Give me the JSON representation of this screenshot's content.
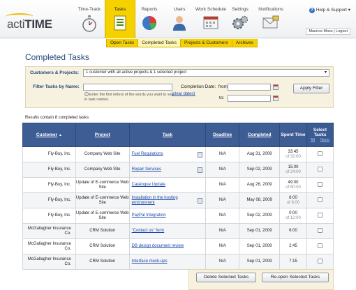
{
  "app": {
    "logo_acti": "acti",
    "logo_time": "TIME"
  },
  "nav": [
    {
      "label": "Time-Track"
    },
    {
      "label": "Tasks"
    },
    {
      "label": "Reports"
    },
    {
      "label": "Users"
    },
    {
      "label": "Work Schedule"
    },
    {
      "label": "Settings"
    },
    {
      "label": "Notifications"
    }
  ],
  "help": {
    "label": "Help & Support",
    "caret": "▾"
  },
  "user": {
    "name": "Maurice Moss",
    "logout": "Logout"
  },
  "subnav": [
    "Open Tasks",
    "Completed Tasks",
    "Projects & Customers",
    "Archives"
  ],
  "page": {
    "title": "Completed Tasks"
  },
  "filter": {
    "cp_label": "Customers & Projects:",
    "cp_value": "1 customer with all active projects & 1 selected project",
    "name_label": "Filter Tasks by Name:",
    "hint": "Enter the first letters of the words you want to see in task names.",
    "date_label": "Completion Date:",
    "from": "from:",
    "to": "to:",
    "clear": "(clear dates)",
    "apply": "Apply Filter"
  },
  "results": {
    "text": "Results contain 8 completed tasks"
  },
  "table": {
    "headers": {
      "customer": "Customer",
      "project": "Project",
      "task": "Task",
      "deadline": "Deadline",
      "completed": "Completed",
      "spent": "Spent Time",
      "select": "Select Tasks",
      "all": "All",
      "none": "None",
      "sort_arrow": "▲"
    },
    "rows": [
      {
        "customer": "Fly-Buy, Inc.",
        "project": "Company Web Site",
        "task": "Fuel Regulations",
        "note": true,
        "deadline": "N/A",
        "completed": "Aug 31, 2009",
        "time": "33:45",
        "of": "of 32:00"
      },
      {
        "customer": "Fly-Buy, Inc.",
        "project": "Company Web Site",
        "task": "Repair Services",
        "note": true,
        "deadline": "N/A",
        "completed": "Sep 02, 2009",
        "time": "15:00",
        "of": "of 24:00"
      },
      {
        "customer": "Fly-Buy, Inc.",
        "project": "Update of E-commerce Web Site",
        "task": "Catalogue Update",
        "note": false,
        "deadline": "N/A",
        "completed": "Aug 26, 2009",
        "time": "49:00",
        "of": "of 60:00"
      },
      {
        "customer": "Fly-Buy, Inc.",
        "project": "Update of E-commerce Web Site",
        "task": "Installation in the hosting environment",
        "note": true,
        "deadline": "N/A",
        "completed": "May 08, 2009",
        "time": "8:00",
        "of": "of 8:00"
      },
      {
        "customer": "Fly-Buy, Inc.",
        "project": "Update of E-commerce Web Site",
        "task": "PayPal Integration",
        "note": false,
        "deadline": "N/A",
        "completed": "Sep 02, 2009",
        "time": "0:00",
        "of": "of 12:00"
      },
      {
        "customer": "McGallagher Insurance Co.",
        "project": "CRM Solution",
        "task": "\"Contact us\" form",
        "note": false,
        "deadline": "N/A",
        "completed": "Sep 01, 2009",
        "time": "6:00",
        "of": ""
      },
      {
        "customer": "McGallagher Insurance Co.",
        "project": "CRM Solution",
        "task": "DB design document review",
        "note": false,
        "deadline": "N/A",
        "completed": "Sep 01, 2009",
        "time": "2:45",
        "of": ""
      },
      {
        "customer": "McGallagher Insurance Co.",
        "project": "CRM Solution",
        "task": "Interface mock-ups",
        "note": false,
        "deadline": "N/A",
        "completed": "Sep 01, 2009",
        "time": "7:15",
        "of": ""
      }
    ]
  },
  "actions": {
    "delete": "Delete Selected Tasks",
    "reopen": "Re-open Selected Tasks"
  },
  "colors": {
    "accent": "#f5d100",
    "header_blue": "#3d5d94",
    "link": "#1a48a8",
    "panel": "#f7f1df"
  }
}
